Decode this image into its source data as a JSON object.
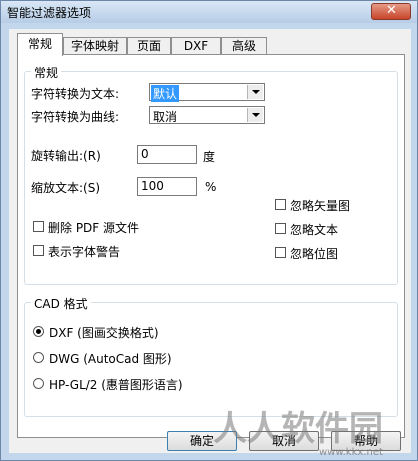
{
  "window": {
    "title": "智能过滤器选项"
  },
  "tabs": [
    "常规",
    "字体映射",
    "页面",
    "DXF",
    "高级"
  ],
  "general_group": {
    "label": "常规",
    "text_convert_label": "字符转换为文本:",
    "text_convert_value": "默认",
    "curve_convert_label": "字符转换为曲线:",
    "curve_convert_value": "取消",
    "rotate_label": "旋转输出:(R)",
    "rotate_value": "0",
    "rotate_unit": "度",
    "scale_label": "缩放文本:(S)",
    "scale_value": "100",
    "scale_unit": "%",
    "ignore_vector": "忽略矢量图",
    "ignore_text": "忽略文本",
    "ignore_bitmap": "忽略位图",
    "delete_pdf_source": "删除 PDF 源文件",
    "show_font_warning": "表示字体警告"
  },
  "cad_group": {
    "label": "CAD 格式",
    "options": [
      "DXF (图画交换格式)",
      "DWG (AutoCad 图形)",
      "HP-GL/2 (惠普图形语言)"
    ],
    "selected_index": 0
  },
  "buttons": {
    "ok": "确定",
    "cancel": "取消",
    "help": "帮助"
  },
  "watermark": {
    "text": "人人软件园",
    "url": "www.kkx.net"
  }
}
